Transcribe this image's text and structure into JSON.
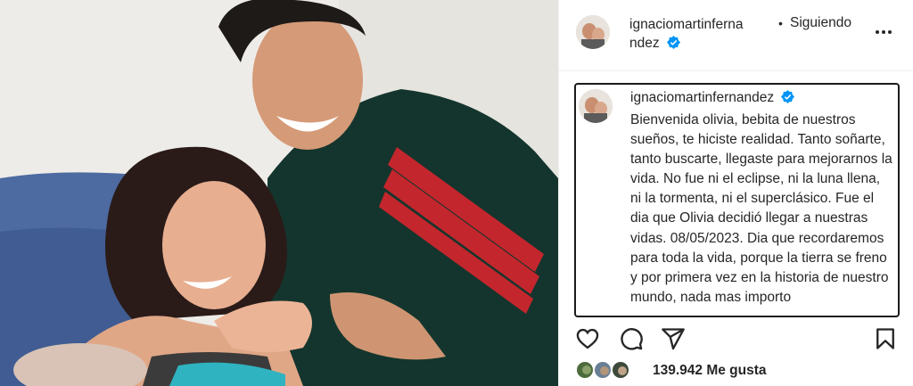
{
  "post": {
    "image_alt": "Foto de una pareja con su bebé recién nacida"
  },
  "header": {
    "username_line1": "ignaciomartinferna",
    "username_line2": "ndez",
    "dot": "•",
    "following": "Siguiendo",
    "more_icon": "more-horizontal-icon"
  },
  "caption": {
    "username": "ignaciomartinfernandez",
    "text": "Bienvenida olivia, bebita de nuestros sueños, te hiciste realidad. Tanto soñarte, tanto buscarte, llegaste para mejorarnos la vida. No fue ni el eclipse, ni la luna llena, ni la tormenta, ni el superclásico. Fue el dia que Olivia decidió llegar a nuestras vidas. 08/05/2023. Dia que recordaremos para toda la vida, porque la tierra se freno y por primera vez en la historia de nuestro mundo, nada mas importo"
  },
  "actions": {
    "like_icon": "heart-icon",
    "comment_icon": "comment-icon",
    "share_icon": "send-icon",
    "save_icon": "bookmark-icon"
  },
  "likes": {
    "count": "139.942",
    "label": "Me gusta"
  },
  "colors": {
    "verified": "#0095f6",
    "text": "#262626",
    "border": "#efefef"
  }
}
